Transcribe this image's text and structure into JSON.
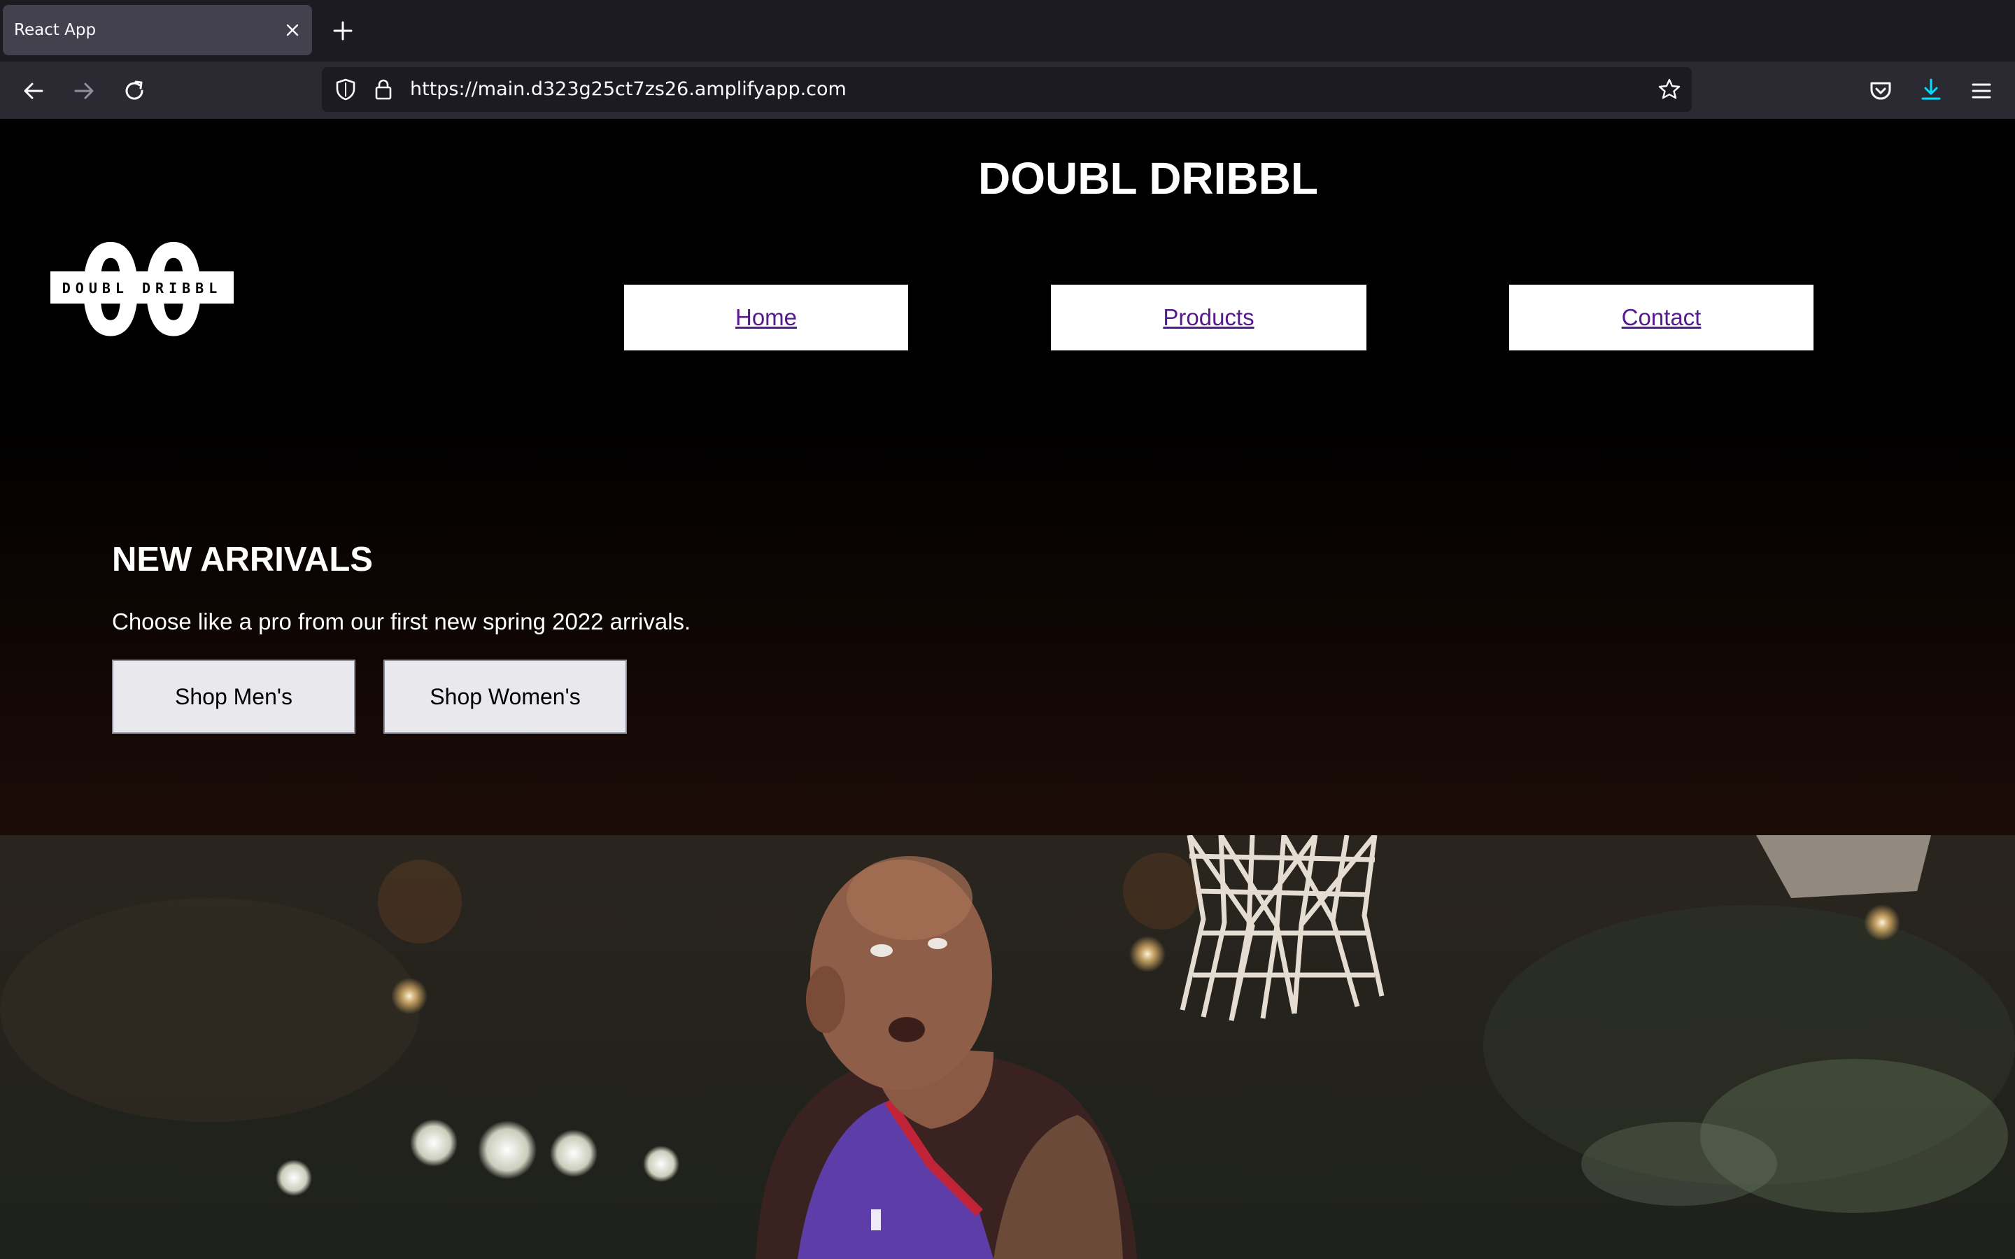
{
  "browser": {
    "tab": {
      "title": "React App"
    },
    "url": "https://main.d323g25ct7zs26.amplifyapp.com"
  },
  "site": {
    "title": "DOUBL DRIBBL",
    "logo": {
      "monogram": "00",
      "wordmark": "DOUBL DRIBBL"
    },
    "nav": [
      {
        "label": "Home"
      },
      {
        "label": "Products"
      },
      {
        "label": "Contact"
      }
    ]
  },
  "hero": {
    "heading": "NEW ARRIVALS",
    "text": "Choose like a pro from our first new spring 2022 arrivals.",
    "buttons": [
      {
        "label": "Shop Men's"
      },
      {
        "label": "Shop Women's"
      }
    ]
  },
  "colors": {
    "chrome_tabbar": "#1c1b22",
    "chrome_toolbar": "#2b2a33",
    "link": "#551a8b",
    "download_accent": "#00ddff"
  }
}
